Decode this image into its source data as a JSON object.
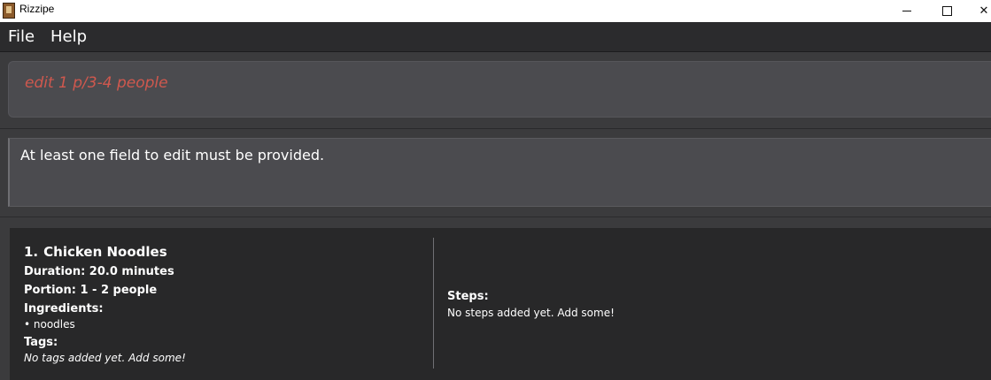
{
  "window": {
    "title": "Rizzipe",
    "icon": "recipe-book-icon",
    "controls": {
      "minimize": "minimize-icon",
      "maximize": "maximize-icon",
      "close": "✕"
    }
  },
  "menu": {
    "items": [
      {
        "label": "File"
      },
      {
        "label": "Help"
      }
    ]
  },
  "command_box": {
    "value": "edit 1 p/3-4 people",
    "text_color": "#d0584e",
    "style": "error"
  },
  "result_display": {
    "text": "At least one field to edit must be provided."
  },
  "recipes": [
    {
      "index": "1.",
      "name": "Chicken Noodles",
      "duration": "Duration: 20.0 minutes",
      "portion": "Portion: 1 - 2 people",
      "ingredients_label": "Ingredients:",
      "ingredients": [
        "• noodles"
      ],
      "tags_label": "Tags:",
      "tags_empty": "No tags added yet. Add some!",
      "steps_label": "Steps:",
      "steps_empty": "No steps added yet. Add some!"
    }
  ]
}
